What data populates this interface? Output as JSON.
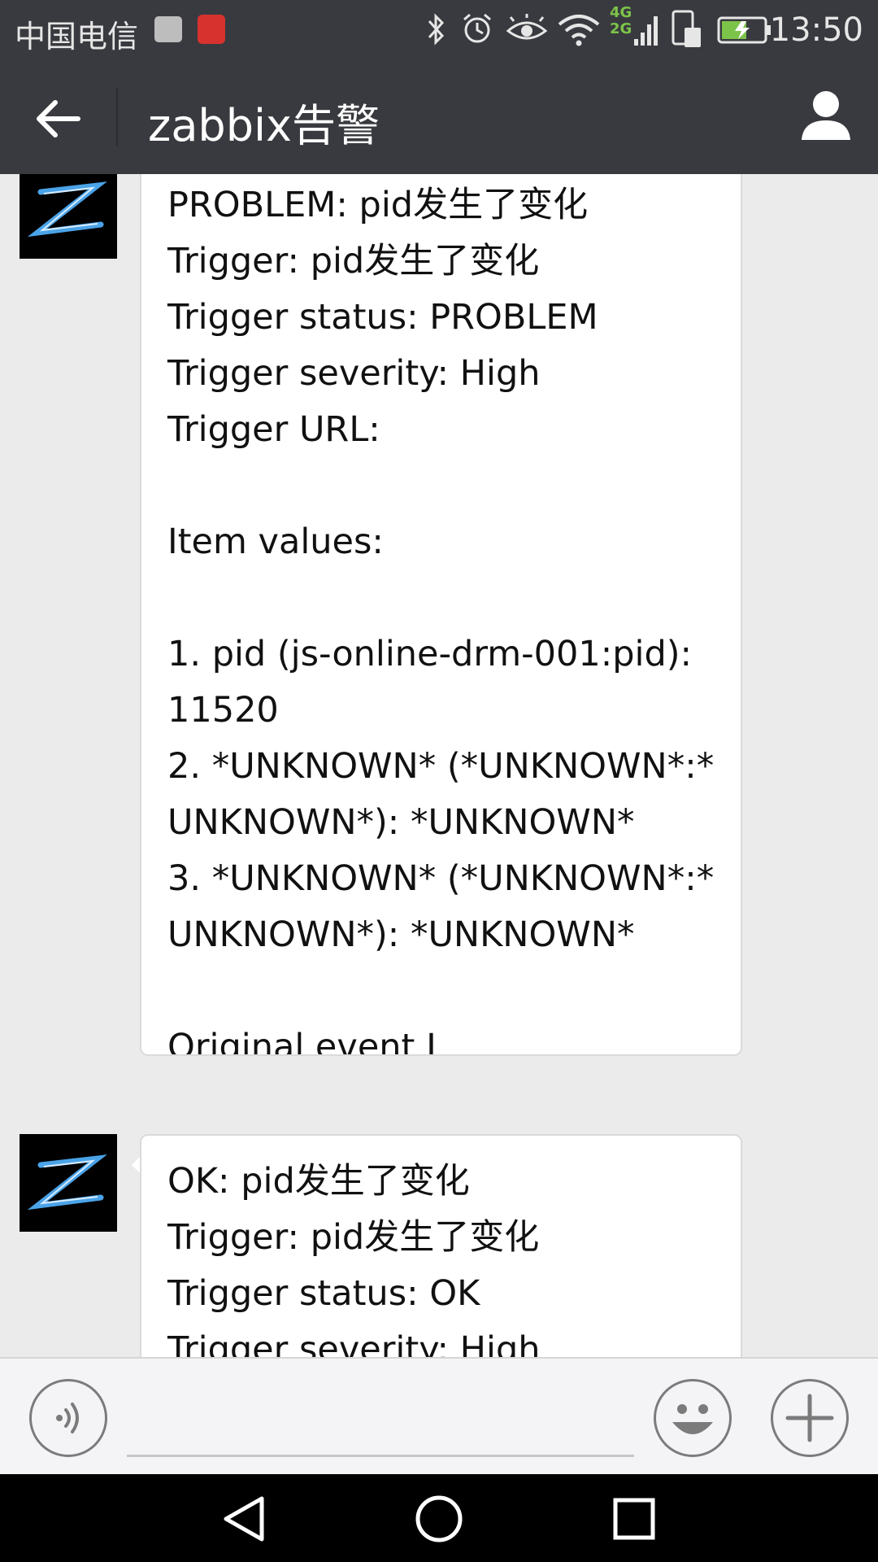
{
  "status_bar": {
    "carrier": "中国电信",
    "network": [
      "4G",
      "2G"
    ],
    "time": "13:50",
    "icons": [
      "mail-notification-icon",
      "jd-app-icon",
      "bluetooth-icon",
      "alarm-icon",
      "eye-icon",
      "wifi-icon",
      "signal-icon",
      "sim-icon",
      "battery-charging-icon"
    ]
  },
  "header": {
    "title": "zabbix告警"
  },
  "messages": [
    {
      "lines": [
        "PROBLEM: pid发生了变化",
        "Trigger: pid发生了变化",
        "Trigger status: PROBLEM",
        "Trigger severity: High",
        "Trigger URL:",
        "",
        "Item values:",
        "",
        "1. pid (js-online-drm-001:pid):",
        "11520",
        "2. *UNKNOWN* (*UNKNOWN*:*",
        "UNKNOWN*): *UNKNOWN*",
        "3. *UNKNOWN* (*UNKNOWN*:*",
        "UNKNOWN*): *UNKNOWN*",
        "",
        "Original event I"
      ]
    },
    {
      "lines": [
        "OK: pid发生了变化",
        "Trigger: pid发生了变化",
        "Trigger status: OK",
        "Trigger severity: High"
      ]
    }
  ],
  "colors": {
    "bar": "#393a3f",
    "chat_bg": "#ebebeb",
    "bubble": "#ffffff"
  }
}
